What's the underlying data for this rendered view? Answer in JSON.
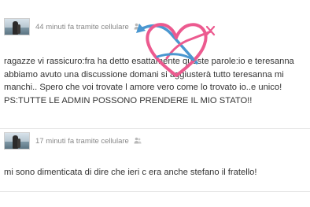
{
  "posts": [
    {
      "meta": "44 minuti fa tramite cellulare",
      "text": "ragazze vi rassicuro:fra ha detto esattamente queste parole:io e teresanna abbiamo avuto una discussione domani si aggiusterà tutto teresanna mi manchi.. Spero che voi trovate l amore vero come lo trovato io..e unico! PS:TUTTE LE ADMIN POSSONO PRENDERE IL MIO STATO!!"
    },
    {
      "meta": "17 minuti fa tramite cellulare",
      "text": "mi sono dimenticata di dire che ieri c era anche stefano il fratello!"
    }
  ],
  "icons": {
    "meta": "people-icon",
    "overlay": "heart-arrows-logo"
  },
  "colors": {
    "logo_pink": "#ec5a8f",
    "logo_blue": "#4a97d0",
    "meta_text": "#888888",
    "body_text": "#333333"
  }
}
